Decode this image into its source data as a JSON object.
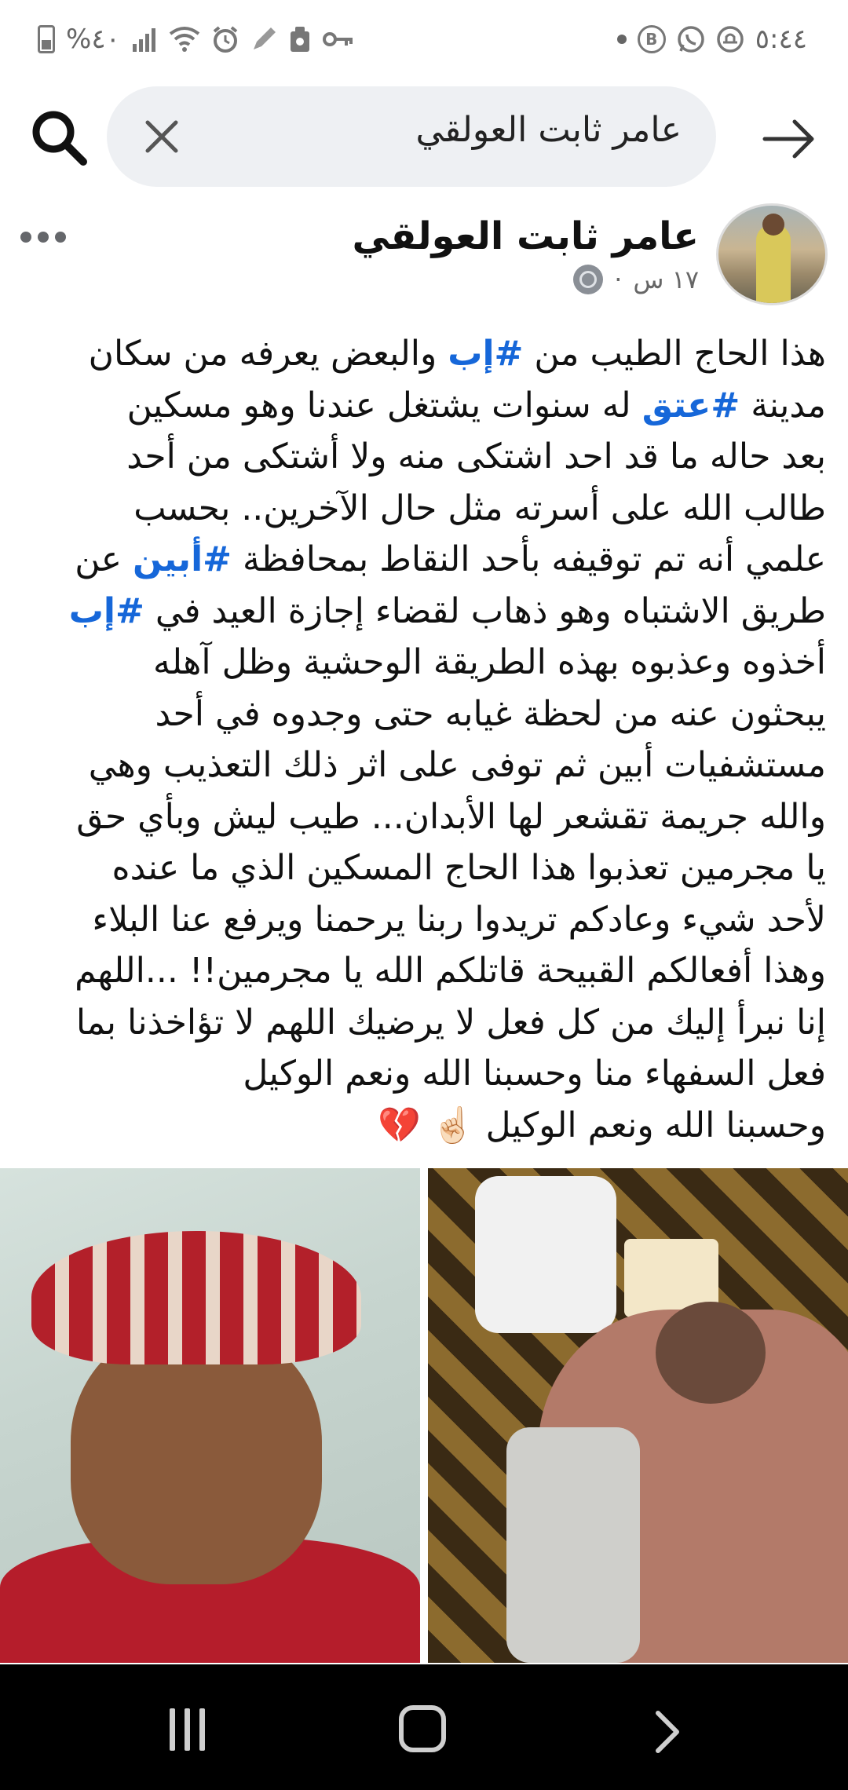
{
  "status_bar": {
    "time": "٥:٤٤",
    "battery_percent": "%٤٠",
    "left_icons": [
      "battery-icon",
      "signal-icon",
      "wifi-icon",
      "alarm-icon",
      "edit-icon",
      "tray-icon",
      "key-icon"
    ],
    "right_icons": [
      "dot-icon",
      "b-icon",
      "whatsapp-icon",
      "app-icon"
    ]
  },
  "search": {
    "query": "عامر ثابت العولقي"
  },
  "post": {
    "author": "عامر ثابت العولقي",
    "time": "١٧ س",
    "separator": "·",
    "lines": [
      [
        "هذا الحاج الطيب من ",
        "#إب",
        " والبعض يعرفه من سكان"
      ],
      [
        "مدينة ",
        "#عتق",
        " له سنوات يشتغل عندنا وهو مسكين"
      ],
      [
        "بعد حاله ما قد احد اشتكى منه ولا أشتكى من أحد"
      ],
      [
        "طالب الله على أسرته مثل حال الآخرين.. بحسب"
      ],
      [
        "علمي أنه تم توقيفه بأحد النقاط بمحافظة ",
        "#أبين",
        " عن"
      ],
      [
        "طريق الاشتباه وهو ذهاب لقضاء إجازة العيد في ",
        "#إب"
      ],
      [
        "أخذوه وعذبوه بهذه الطريقة الوحشية وظل آهله"
      ],
      [
        "يبحثون عنه من لحظة غيابه حتى وجدوه في أحد"
      ],
      [
        "مستشفيات أبين ثم توفى على اثر ذلك التعذيب وهي"
      ],
      [
        "والله جريمة تقشعر لها الأبدان... طيب ليش وبأي حق"
      ],
      [
        "يا مجرمين تعذبوا هذا الحاج المسكين الذي ما عنده"
      ],
      [
        "لأحد شيء وعادكم تريدوا ربنا يرحمنا ويرفع عنا البلاء"
      ],
      [
        "وهذا أفعالكم القبيحة قاتلكم الله يا مجرمين!! ...اللهم"
      ],
      [
        "إنا نبرأ إليك من كل فعل لا يرضيك اللهم لا تؤاخذنا بما"
      ],
      [
        "فعل السفهاء منا وحسبنا الله ونعم الوكيل"
      ],
      [
        "وحسبنا الله ونعم الوكيل ☝🏻 💔"
      ]
    ]
  },
  "colors": {
    "hashtag": "#1667d9",
    "search_bg": "#eef0f3"
  }
}
